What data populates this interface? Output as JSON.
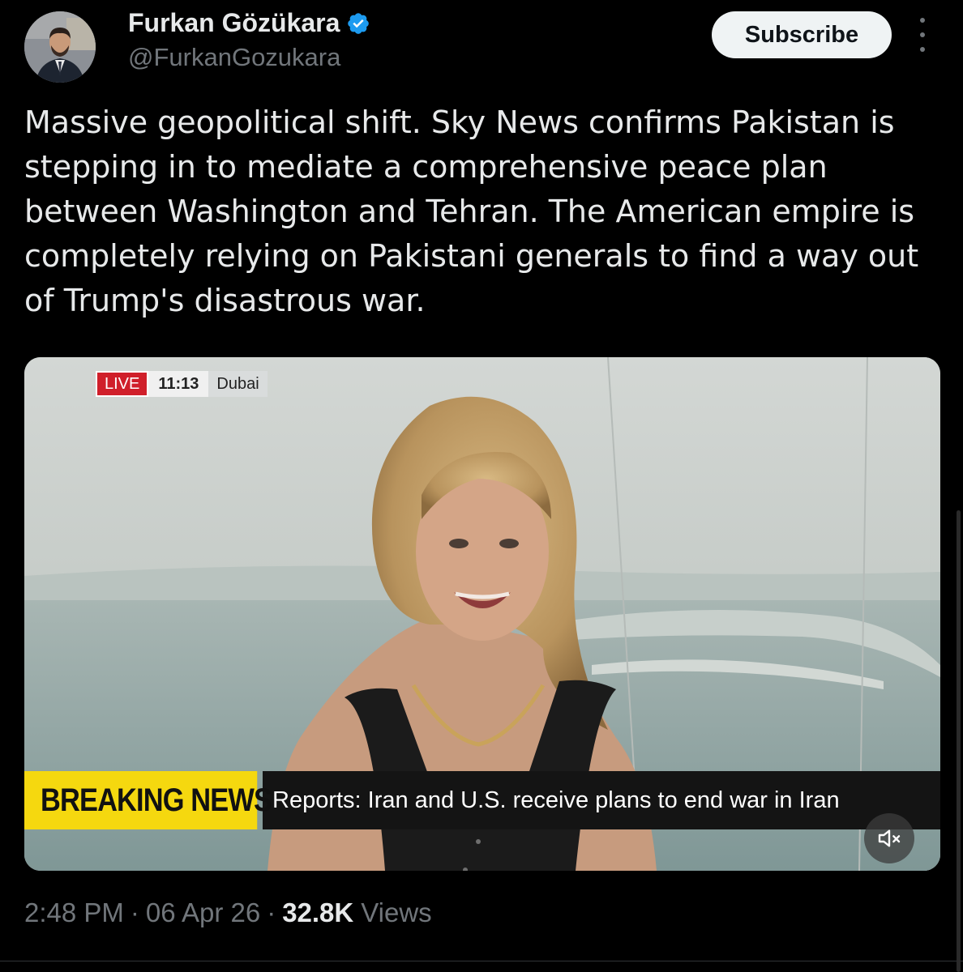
{
  "author": {
    "display_name": "Furkan Gözükara",
    "handle": "@FurkanGozukara",
    "avatar_icon": "profile-photo",
    "verified_icon": "verified-badge-icon",
    "verified_color": "#1d9bf0"
  },
  "actions": {
    "subscribe_label": "Subscribe",
    "more_icon": "more-vertical-icon"
  },
  "post": {
    "text": "Massive geopolitical shift. Sky News confirms Pakistan is stepping in to mediate a comprehensive peace plan between Washington and Tehran. The American empire is completely relying on Pakistani generals to find a way out of Trump's disastrous war."
  },
  "media": {
    "live_badge": "LIVE",
    "time": "11:13",
    "location": "Dubai",
    "breaking_label": "BREAKING NEWS",
    "headline": "Reports: Iran and U.S. receive plans to end war in Iran",
    "mute_icon": "volume-muted-icon",
    "breaking_color": "#f5d80f",
    "live_color": "#d01f2a"
  },
  "meta": {
    "time": "2:48 PM",
    "date": "06 Apr 26",
    "separator": "·",
    "views_count": "32.8K",
    "views_label": "Views"
  },
  "colors": {
    "background": "#000000",
    "text_primary": "#e7e9ea",
    "text_secondary": "#71767b"
  }
}
